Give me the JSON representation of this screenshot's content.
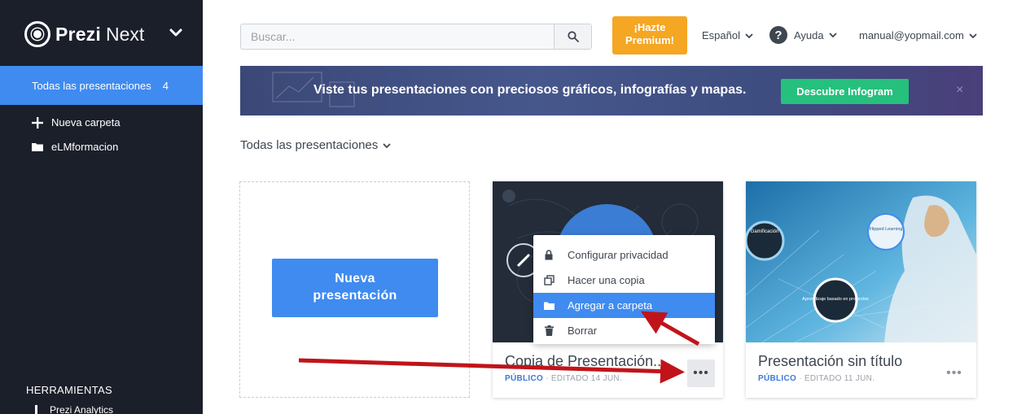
{
  "sidebar": {
    "logo_brand": "Prezi",
    "logo_product": "Next",
    "active_item": {
      "label": "Todas las presentaciones",
      "count": "4"
    },
    "items": [
      {
        "label": "Nueva carpeta",
        "icon": "plus-icon"
      },
      {
        "label": "eLMformacion",
        "icon": "folder-icon"
      }
    ],
    "tools_heading": "HERRAMIENTAS",
    "tools_item": "Prezi Analytics"
  },
  "topbar": {
    "search_placeholder": "Buscar...",
    "premium_line1": "¡Hazte",
    "premium_line2": "Premium!",
    "language": "Español",
    "help": "Ayuda",
    "user": "manual@yopmail.com"
  },
  "banner": {
    "text": "Viste tus presentaciones con preciosos gráficos, infografías y mapas.",
    "button": "Descubre Infogram",
    "close": "×"
  },
  "breadcrumb": "Todas las presentaciones",
  "new_presentation": {
    "line1": "Nueva",
    "line2": "presentación"
  },
  "cards": [
    {
      "title": "Copia de Presentación...",
      "visibility": "PÚBLICO",
      "edited": "· EDITADO 14 JUN.",
      "more": "•••"
    },
    {
      "title": "Presentación sin título",
      "visibility": "PÚBLICO",
      "edited": "· EDITADO 11 JUN.",
      "more": "•••",
      "thumb_labels": {
        "a": "Gamificación",
        "b": "Flipped Learning",
        "c": "Aprendizaje basado en proyectos"
      }
    }
  ],
  "menu": [
    {
      "label": "Configurar privacidad",
      "icon": "lock-icon"
    },
    {
      "label": "Hacer una copia",
      "icon": "copy-icon"
    },
    {
      "label": "Agregar a carpeta",
      "icon": "folder-icon",
      "highlighted": true
    },
    {
      "label": "Borrar",
      "icon": "trash-icon"
    }
  ],
  "colors": {
    "sidebar": "#1b1f2a",
    "accent": "#3f8bf0",
    "premium": "#f5a623",
    "banner_button": "#26c07d",
    "arrow": "#c0141a"
  }
}
